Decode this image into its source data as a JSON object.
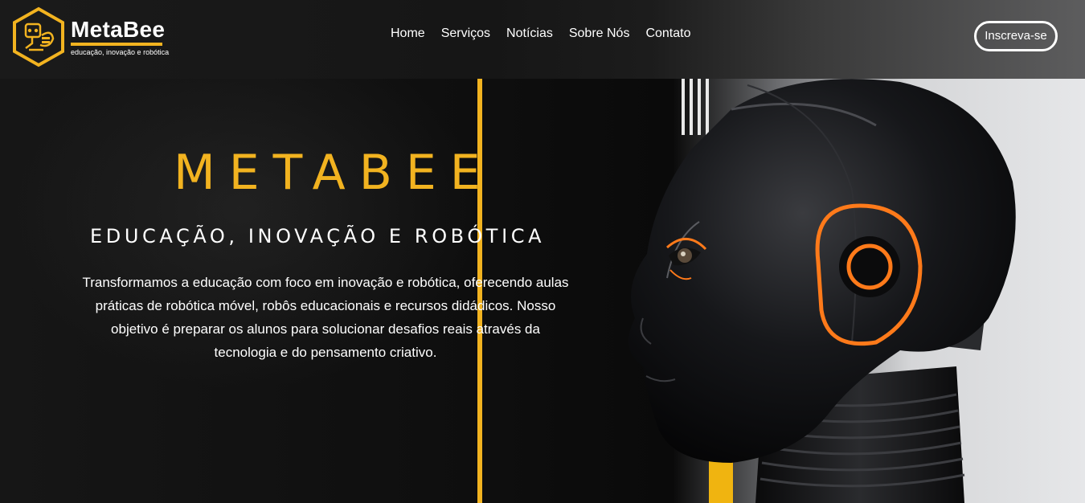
{
  "brand": {
    "name": "MetaBee",
    "tagline": "educação, inovação e robótica",
    "accent_color": "#f2b320",
    "logo_icon": "hexagon-robot-bee-logo"
  },
  "nav": {
    "items": [
      {
        "label": "Home"
      },
      {
        "label": "Serviços"
      },
      {
        "label": "Notícias"
      },
      {
        "label": "Sobre Nós"
      },
      {
        "label": "Contato"
      }
    ],
    "cta_label": "Inscreva-se"
  },
  "hero": {
    "title": "METABEE",
    "subtitle": "EDUCAÇÃO, INOVAÇÃO E ROBÓTICA",
    "description": "Transformamos a educação com foco em inovação e robótica, oferecendo aulas práticas de robótica móvel, robôs educacionais e recursos didádicos. Nosso objetivo é preparar os alunos para solucionar desafios reais através da tecnologia e do pensamento criativo.",
    "image": "robot-head-image"
  }
}
